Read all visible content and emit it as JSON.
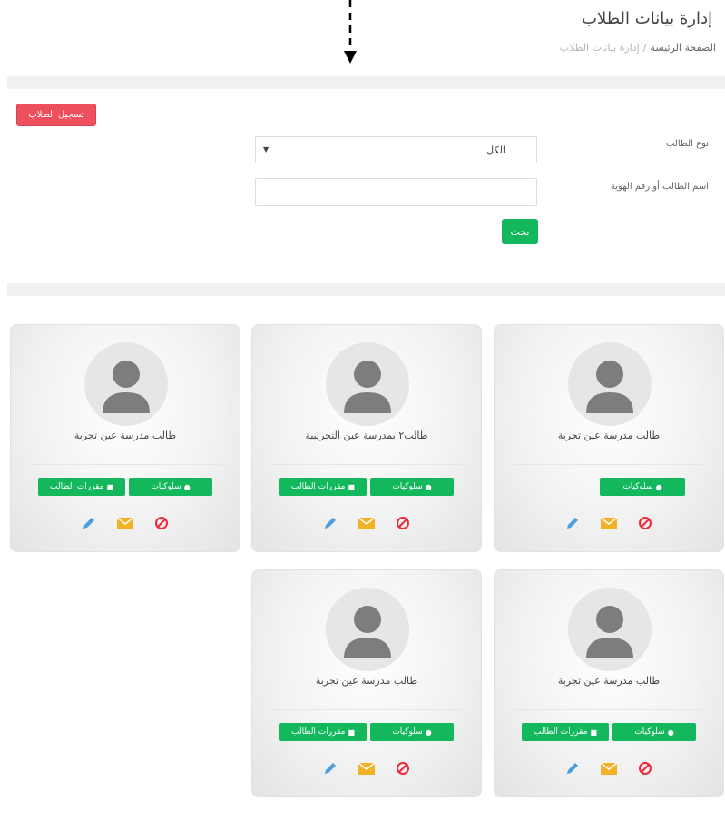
{
  "header": {
    "title": "إدارة بيانات الطلاب",
    "breadcrumb": {
      "home": "الصفحة الرئيسة",
      "separator": "/",
      "current": "إدارة بيانات الطلاب"
    }
  },
  "filters": {
    "add_button": "تسجيل الطلاب",
    "type_label": "نوع الطالب",
    "type_value": "الكل",
    "name_label": "اسم الطالب أو رقم الهوية",
    "name_value": "",
    "search_button": "بحث"
  },
  "colors": {
    "green": "#14b85c",
    "red": "#ee4f5c",
    "orange": "#f3b127",
    "blue": "#4a9fdc"
  },
  "students": [
    {
      "name": "طالب مدرسة عين تجربة",
      "behaviors_label": "سلوكيات",
      "courses_label": ""
    },
    {
      "name": "طالب٢ بمدرسة عين التجريبية",
      "behaviors_label": "سلوكيات",
      "courses_label": "مقررات الطالب"
    },
    {
      "name": "طالب مدرسة عين تجربة",
      "behaviors_label": "سلوكيات",
      "courses_label": "مقررات الطالب"
    },
    {
      "name": "طالب مدرسة عين تجربة",
      "behaviors_label": "سلوكيات",
      "courses_label": "مقررات الطالب"
    },
    {
      "name": "طالب مدرسة عين تجربة",
      "behaviors_label": "سلوكيات",
      "courses_label": "مقررات الطالب"
    }
  ],
  "icons": {
    "edit": "pencil-icon",
    "message": "envelope-icon",
    "block": "ban-icon",
    "behaviors": "user-icon",
    "courses": "book-icon"
  }
}
